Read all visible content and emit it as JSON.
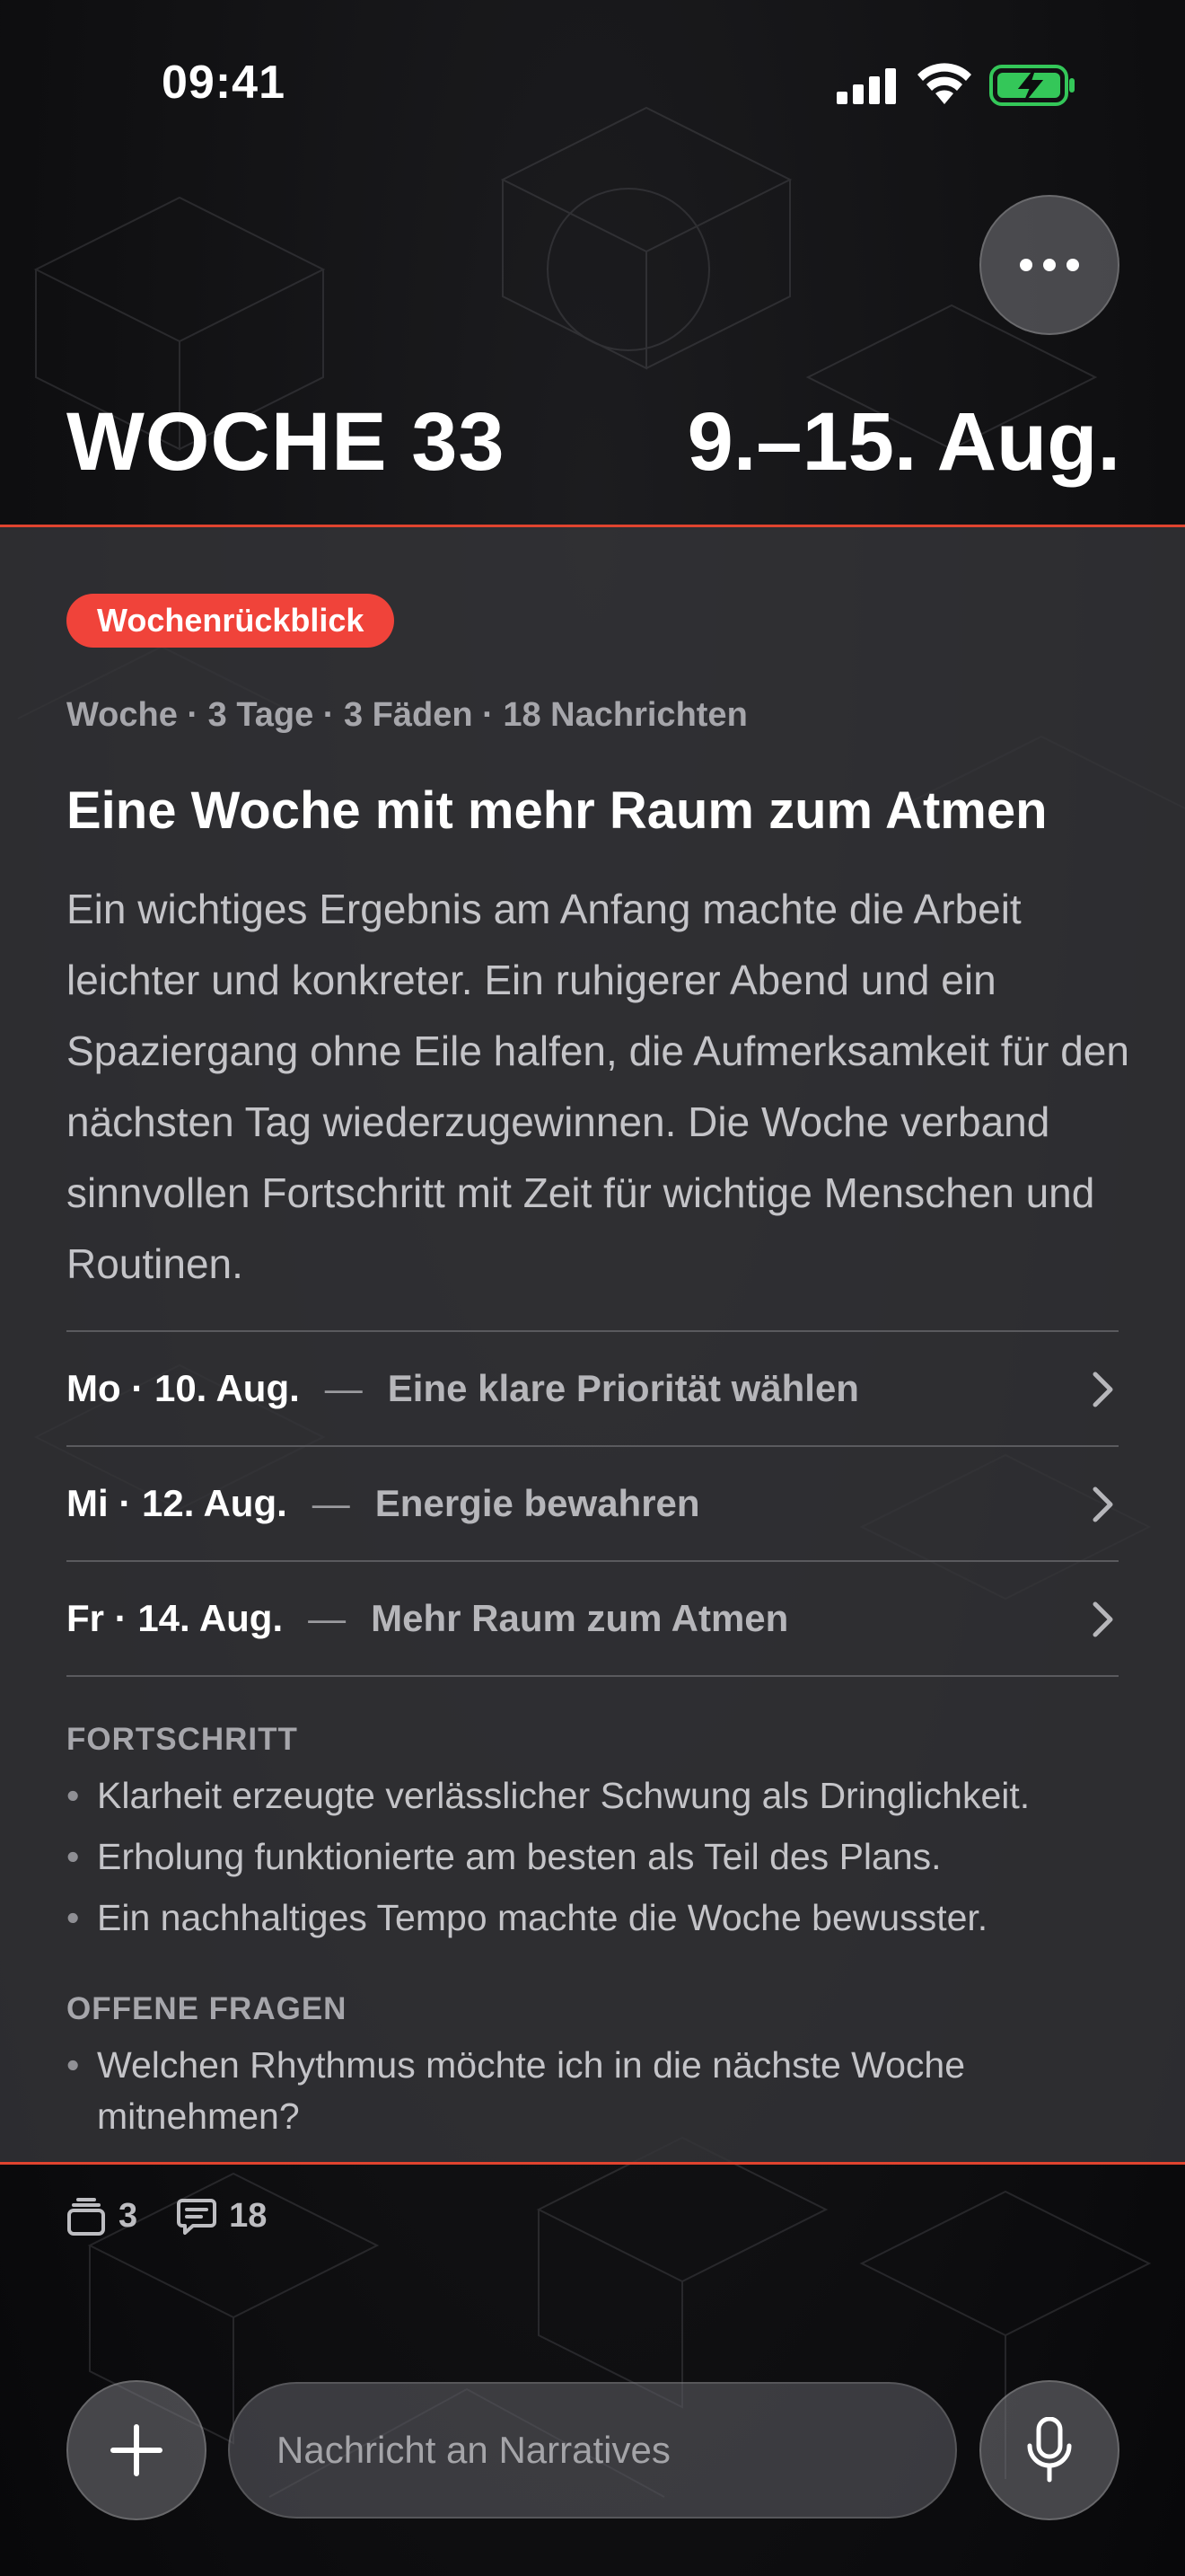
{
  "status_bar": {
    "time": "09:41"
  },
  "header": {
    "week_title": "WOCHE 33",
    "date_range": "9.–15. Aug."
  },
  "card": {
    "badge": "Wochenrückblick",
    "meta": "Woche · 3 Tage · 3 Fäden · 18 Nachrichten",
    "title": "Eine Woche mit mehr Raum zum Atmen",
    "body": "Ein wichtiges Ergebnis am Anfang machte die Arbeit leichter und konkreter. Ein ruhigerer Abend und ein Spaziergang ohne Eile halfen, die Aufmerksamkeit für den nächsten Tag wiederzugewinnen. Die Woche verband sinnvollen Fortschritt mit Zeit für wichtige Menschen und Routinen.",
    "days": [
      {
        "date": "Mo · 10. Aug.",
        "dash": "—",
        "title": "Eine klare Priorität wählen"
      },
      {
        "date": "Mi · 12. Aug.",
        "dash": "—",
        "title": "Energie bewahren"
      },
      {
        "date": "Fr · 14. Aug.",
        "dash": "—",
        "title": "Mehr Raum zum Atmen"
      }
    ],
    "progress": {
      "heading": "FORTSCHRITT",
      "items": [
        "Klarheit erzeugte verlässlicher Schwung als Dringlichkeit.",
        "Erholung funktionierte am besten als Teil des Plans.",
        "Ein nachhaltiges Tempo machte die Woche bewusster."
      ]
    },
    "questions": {
      "heading": "OFFENE FRAGEN",
      "items": [
        "Welchen Rhythmus möchte ich in die nächste Woche mitnehmen?"
      ]
    },
    "bullet_mark": "•"
  },
  "counts": {
    "threads": "3",
    "messages": "18"
  },
  "composer": {
    "placeholder": "Nachricht an Narratives"
  },
  "colors": {
    "accent": "#f0433a",
    "divider": "#e0442f",
    "battery": "#34c759"
  },
  "icons": [
    "signal-icon",
    "wifi-icon",
    "battery-charging-icon",
    "more-icon",
    "chevron-right-icon",
    "stack-icon",
    "chat-bubble-icon",
    "plus-icon",
    "microphone-icon"
  ]
}
